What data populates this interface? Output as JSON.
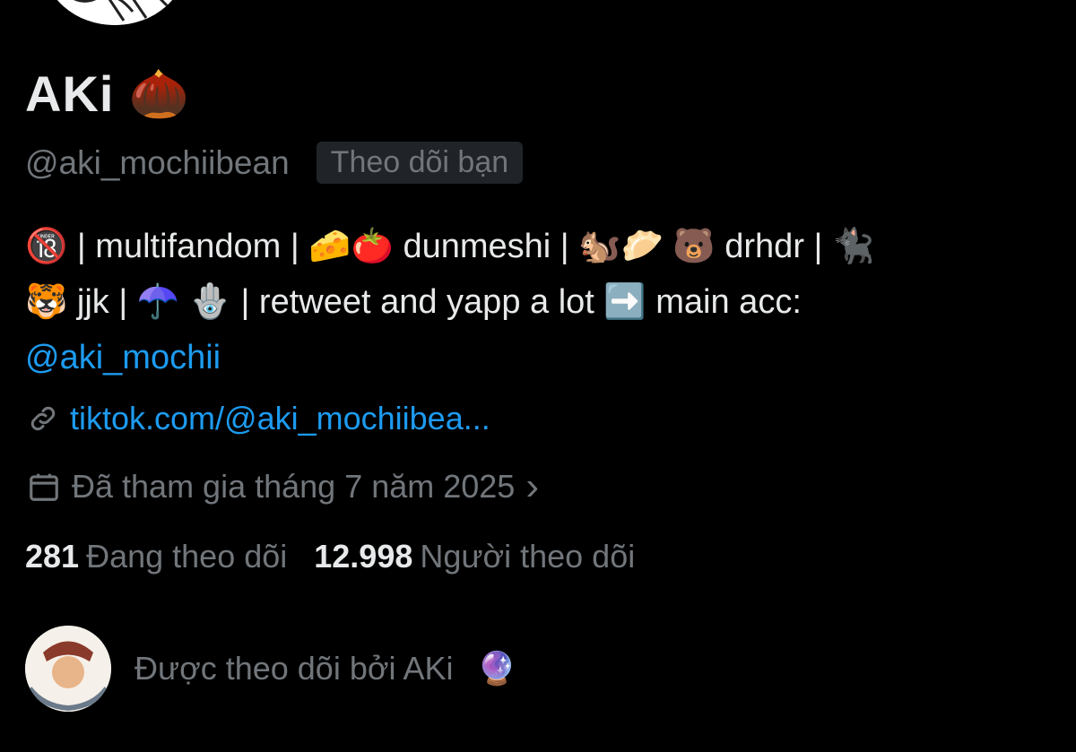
{
  "profile": {
    "display_name": "AKi",
    "name_emoji": "🌰",
    "handle": "@aki_mochiibean",
    "follows_you_badge": "Theo dõi bạn"
  },
  "bio": {
    "part1": "🔞 | multifandom | 🧀🍅 dunmeshi | 🐿️🥟 🐻 drhdr | 🐈‍⬛",
    "part2": "🐯 jjk | ☂️ 🪬 | retweet and yapp a lot ➡️ main acc:",
    "mention": "@aki_mochii"
  },
  "link": {
    "icon": "link-icon",
    "url_text": "tiktok.com/@aki_mochiibea..."
  },
  "joined": {
    "icon": "calendar-icon",
    "text": "Đã tham gia tháng 7 năm 2025",
    "chevron": "›"
  },
  "stats": {
    "following_count": "281",
    "following_label": "Đang theo dõi",
    "followers_count": "12.998",
    "followers_label": "Người theo dõi"
  },
  "followed_by": {
    "text": "Được theo dõi bởi AKi",
    "emoji": "🔮"
  },
  "colors": {
    "background": "#000000",
    "primary_text": "#e7e9ea",
    "secondary_text": "#71767b",
    "link": "#1d9bf0",
    "badge_bg": "#202327"
  }
}
